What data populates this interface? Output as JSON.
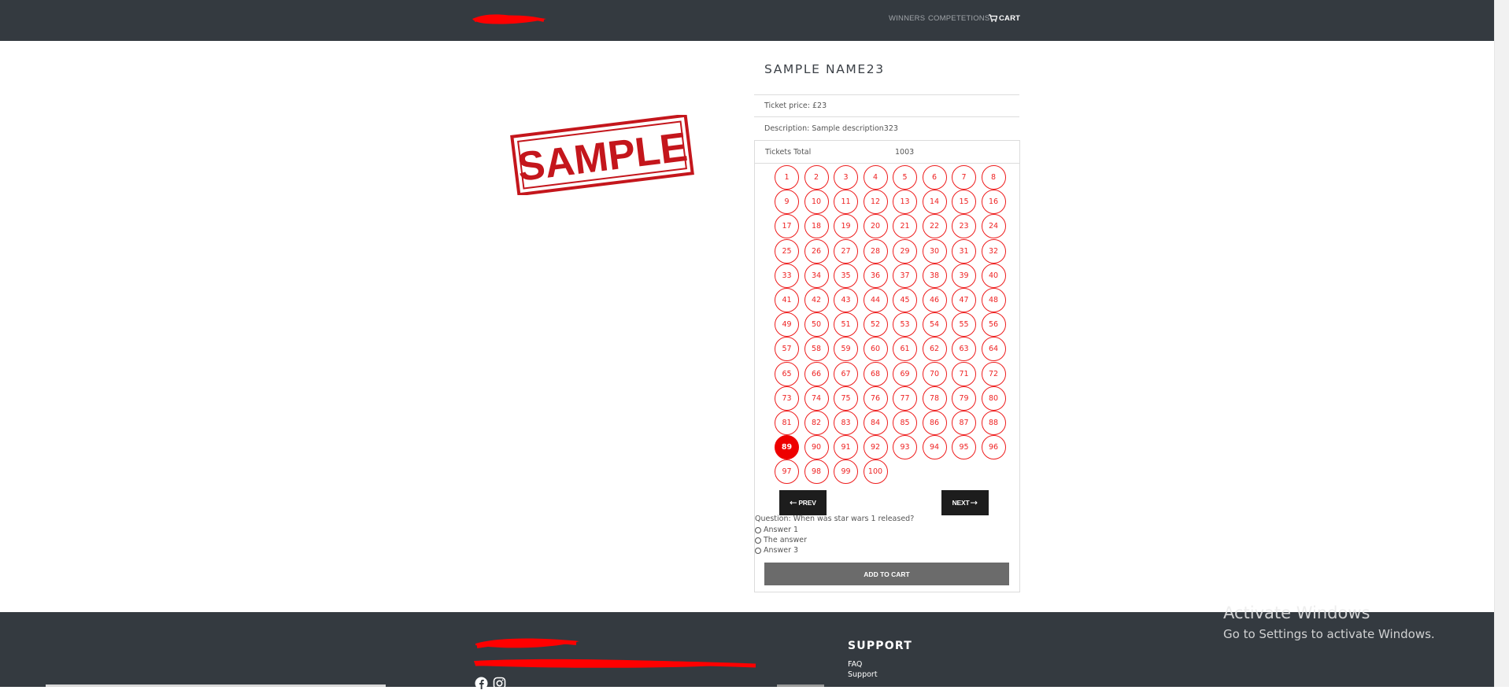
{
  "header": {
    "nav": {
      "winners": "WINNERS",
      "competitions": "COMPETETIONS",
      "cart": "CART"
    }
  },
  "product": {
    "image_stamp_text": "SAMPLE",
    "title": "SAMPLE NAME23",
    "ticket_price": "Ticket price: £23",
    "description": "Description: Sample description323",
    "tickets_total_label": "Tickets Total",
    "tickets_total_value": "1003"
  },
  "tickets": {
    "numbers": [
      "1",
      "2",
      "3",
      "4",
      "5",
      "6",
      "7",
      "8",
      "9",
      "10",
      "11",
      "12",
      "13",
      "14",
      "15",
      "16",
      "17",
      "18",
      "19",
      "20",
      "21",
      "22",
      "23",
      "24",
      "25",
      "26",
      "27",
      "28",
      "29",
      "30",
      "31",
      "32",
      "33",
      "34",
      "35",
      "36",
      "37",
      "38",
      "39",
      "40",
      "41",
      "42",
      "43",
      "44",
      "45",
      "46",
      "47",
      "48",
      "49",
      "50",
      "51",
      "52",
      "53",
      "54",
      "55",
      "56",
      "57",
      "58",
      "59",
      "60",
      "61",
      "62",
      "63",
      "64",
      "65",
      "66",
      "67",
      "68",
      "69",
      "70",
      "71",
      "72",
      "73",
      "74",
      "75",
      "76",
      "77",
      "78",
      "79",
      "80",
      "81",
      "82",
      "83",
      "84",
      "85",
      "86",
      "87",
      "88",
      "89",
      "90",
      "91",
      "92",
      "93",
      "94",
      "95",
      "96",
      "97",
      "98",
      "99",
      "100"
    ],
    "selected": "89",
    "prev_label": "PREV",
    "next_label": "NEXT"
  },
  "quiz": {
    "question": "Question: When was star wars 1 released?",
    "answers": [
      "Answer 1",
      "The answer",
      "Answer 3"
    ]
  },
  "add_to_cart_label": "ADD TO CART",
  "footer": {
    "support_title": "SUPPORT",
    "links": [
      "FAQ",
      "Support"
    ]
  },
  "os_overlay": {
    "line1": "Activate Windows",
    "line2": "Go to Settings to activate Windows."
  },
  "colors": {
    "header_bg": "#343a40",
    "accent_red": "#ee1c1c",
    "button_dark": "#1d1d1d",
    "add_to_cart_bg": "#6b6b6b"
  },
  "icons": [
    "cart-icon",
    "left-arrow-icon",
    "right-arrow-icon",
    "facebook-icon",
    "instagram-icon"
  ]
}
